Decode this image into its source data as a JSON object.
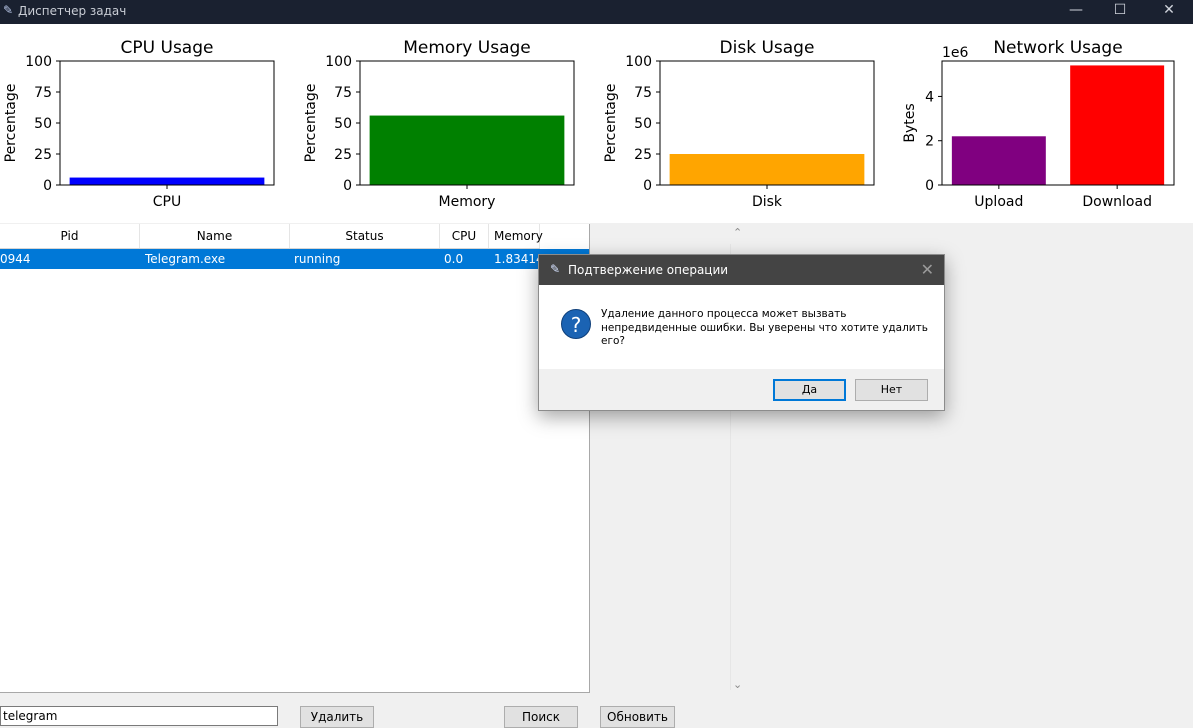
{
  "window": {
    "title": "Диспетчер задач",
    "icon": "feather-icon",
    "controls": {
      "minimize": "—",
      "maximize": "☐",
      "close": "✕"
    }
  },
  "chart_data": [
    {
      "type": "bar",
      "title": "CPU Usage",
      "ylabel": "Percentage",
      "xlabel": "",
      "categories": [
        "CPU"
      ],
      "values": [
        6
      ],
      "ylim": [
        0,
        100
      ],
      "yticks": [
        "0",
        "25",
        "50",
        "75",
        "100"
      ],
      "colors": [
        "#0000ff"
      ]
    },
    {
      "type": "bar",
      "title": "Memory Usage",
      "ylabel": "Percentage",
      "xlabel": "",
      "categories": [
        "Memory"
      ],
      "values": [
        56
      ],
      "ylim": [
        0,
        100
      ],
      "yticks": [
        "0",
        "25",
        "50",
        "75",
        "100"
      ],
      "colors": [
        "#008000"
      ]
    },
    {
      "type": "bar",
      "title": "Disk Usage",
      "ylabel": "Percentage",
      "xlabel": "",
      "categories": [
        "Disk"
      ],
      "values": [
        25
      ],
      "ylim": [
        0,
        100
      ],
      "yticks": [
        "0",
        "25",
        "50",
        "75",
        "100"
      ],
      "colors": [
        "#ffa500"
      ]
    },
    {
      "type": "bar",
      "title": "Network Usage",
      "ylabel": "Bytes",
      "xlabel": "",
      "categories": [
        "Upload",
        "Download"
      ],
      "values": [
        2200000,
        5400000
      ],
      "ylim": [
        0,
        5600000
      ],
      "yticks": [
        "0",
        "2",
        "4"
      ],
      "ytick_values": [
        0,
        2000000,
        4000000
      ],
      "scale_label": "1e6",
      "colors": [
        "#800080",
        "#ff0000"
      ]
    }
  ],
  "table": {
    "columns": [
      "Pid",
      "Name",
      "Status",
      "CPU",
      "Memory"
    ],
    "rows": [
      {
        "pid": "0944",
        "name": "Telegram.exe",
        "status": "running",
        "cpu": "0.0",
        "memory": "1.834142",
        "selected": true
      }
    ]
  },
  "scroll": {
    "up": "⌃",
    "down": "⌄"
  },
  "controls": {
    "search_value": "telegram",
    "delete_label": "Удалить",
    "search_label": "Поиск",
    "refresh_label": "Обновить"
  },
  "dialog": {
    "title": "Подтвержение операции",
    "close": "✕",
    "icon": "question-icon",
    "icon_glyph": "?",
    "message": "Удаление данного процесса может вызвать непредвиденные ошибки. Вы уверены что хотите удалить его?",
    "yes_label": "Да",
    "no_label": "Нет"
  }
}
